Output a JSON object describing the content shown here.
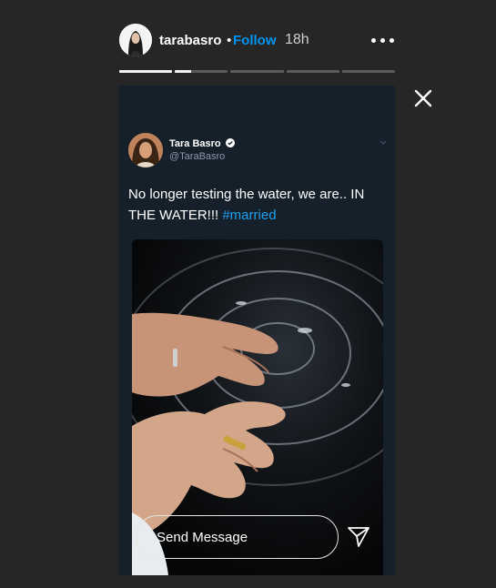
{
  "header": {
    "username": "tarabasro",
    "separator": "•",
    "follow_label": "Follow",
    "time": "18h",
    "avatar_icon": "profile-photo",
    "more_icon": "more-options-icon"
  },
  "progress": {
    "segments": [
      1,
      0.3,
      0,
      0,
      0
    ]
  },
  "close_icon": "close-icon",
  "tweet": {
    "display_name": "Tara Basro",
    "handle": "@TaraBasro",
    "verified_icon": "verified-badge-icon",
    "text_main": "No longer testing the water, we are.. IN THE WATER!!! ",
    "hashtag": "#married"
  },
  "footer": {
    "message_placeholder": "Send Message",
    "send_icon": "send-paper-plane-icon"
  },
  "colors": {
    "background": "#262626",
    "story_bg": "#15202b",
    "follow": "#0095f6",
    "hashtag": "#1da1f2"
  }
}
